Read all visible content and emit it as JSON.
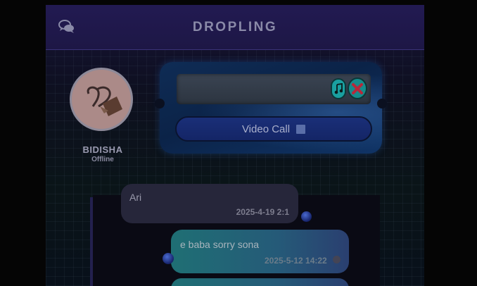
{
  "header": {
    "title": "DROPLING",
    "chat_icon": "chat-bubbles-icon"
  },
  "contact": {
    "name": "BIDISHA",
    "status": "Offline",
    "avatar_icon": "heart-hands-avatar"
  },
  "controls": {
    "music_icon": "music-note-icon",
    "close_icon": "close-x-icon",
    "video_call_label": "Video Call",
    "video_call_icon": "video-camera-icon"
  },
  "messages": [
    {
      "direction": "incoming",
      "text": "Ari",
      "time": "2025-4-19 2:1"
    },
    {
      "direction": "outgoing",
      "text": "e baba sorry sona",
      "time": "2025-5-12 14:22"
    }
  ],
  "colors": {
    "header_bg": "#1d1745",
    "accent_teal": "#1aa0a0",
    "video_btn": "#142566"
  }
}
